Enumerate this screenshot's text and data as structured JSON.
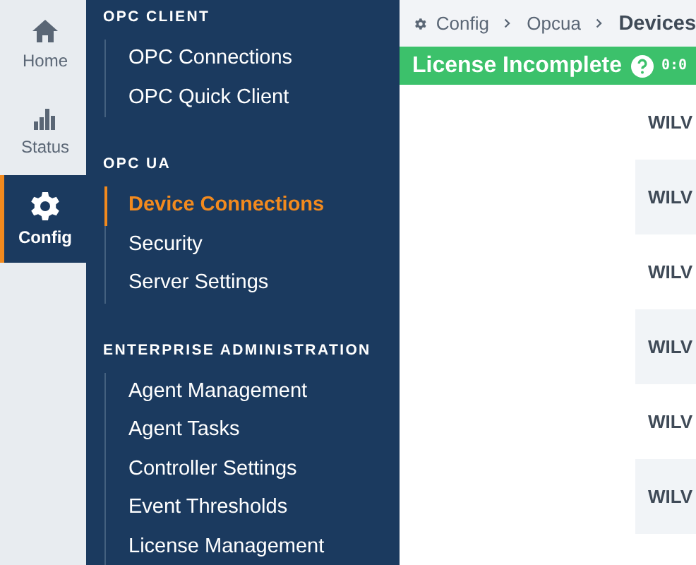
{
  "rail": [
    {
      "label": "Home",
      "selected": false
    },
    {
      "label": "Status",
      "selected": false
    },
    {
      "label": "Config",
      "selected": true
    }
  ],
  "nav_sections": [
    {
      "title": "OPC CLIENT",
      "items": [
        {
          "label": "OPC Connections",
          "selected": false
        },
        {
          "label": "OPC Quick Client",
          "selected": false
        }
      ]
    },
    {
      "title": "OPC UA",
      "items": [
        {
          "label": "Device Connections",
          "selected": true
        },
        {
          "label": "Security",
          "selected": false
        },
        {
          "label": "Server Settings",
          "selected": false
        }
      ]
    },
    {
      "title": "ENTERPRISE ADMINISTRATION",
      "items": [
        {
          "label": "Agent Management",
          "selected": false
        },
        {
          "label": "Agent Tasks",
          "selected": false
        },
        {
          "label": "Controller Settings",
          "selected": false
        },
        {
          "label": "Event Thresholds",
          "selected": false
        },
        {
          "label": "License Management",
          "selected": false
        }
      ]
    }
  ],
  "breadcrumb": [
    "Config",
    "Opcua",
    "Devices"
  ],
  "banner": {
    "text": "License Incomplete",
    "timer": "0:0"
  },
  "rows": [
    "WILV",
    "WILV",
    "WILV",
    "WILV",
    "WILV",
    "WILV"
  ]
}
